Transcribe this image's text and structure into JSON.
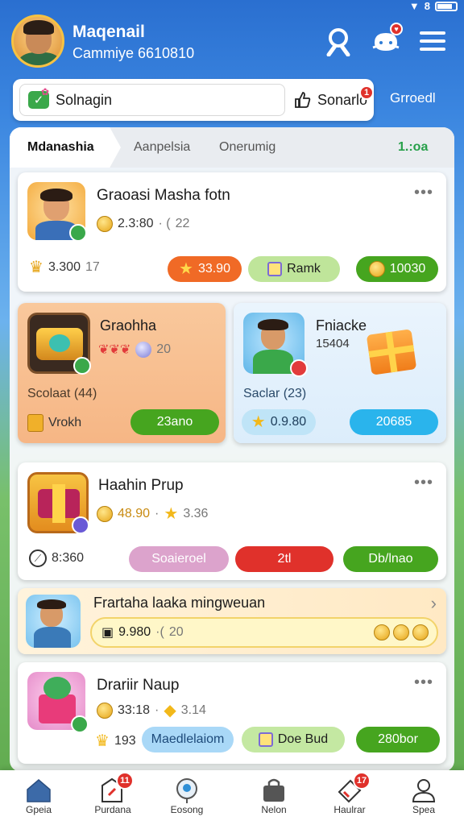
{
  "status": {
    "right_text": "8"
  },
  "header": {
    "username": "Maqenail",
    "subline": "Cammiye 6610810"
  },
  "search": {
    "value": "Solnagin",
    "sort_label": "Sonarlo",
    "sort_badge": "1",
    "group_link": "Grroedl"
  },
  "tabs": [
    {
      "label": "Mdanashia"
    },
    {
      "label": "Aanpelsia"
    },
    {
      "label": "Onerumig"
    }
  ],
  "tabs_right": "1.:oa",
  "cards": {
    "c1": {
      "title": "Graoasi Masha fotn",
      "price": "2.3:80",
      "secondary": "22",
      "score": "3.300",
      "count": "17",
      "btn1": "33.90",
      "btn2": "Ramk",
      "btn3": "10030"
    },
    "c2": {
      "title": "Graohha",
      "rating": "20",
      "subtitle": "Scolaat (44)",
      "tag": "Vrokh",
      "button": "23ano"
    },
    "c3": {
      "title": "Fniacke",
      "sub": "15404",
      "subtitle": "Saclar (23)",
      "chip": "0.9.80",
      "button": "20685"
    },
    "c4": {
      "title": "Haahin Prup",
      "price": "48.90",
      "rating": "3.36",
      "score": "8:360",
      "btn1": "Soaieroel",
      "btn2": "2tl",
      "btn3": "Db/lnao"
    },
    "c5": {
      "title": "Frartaha laaka mingweuan",
      "field": "9.980",
      "field_sub": "20"
    },
    "c6": {
      "title": "Drariir Naup",
      "price": "33:18",
      "rating": "3.14",
      "score": "193",
      "btn1": "Maedlelaiom",
      "btn2": "Doe Bud",
      "btn3": "280bor"
    }
  },
  "nav": [
    {
      "label": "Gpeia"
    },
    {
      "label": "Purdana",
      "badge": "11"
    },
    {
      "label": "Eosong"
    },
    {
      "label": "Nelon"
    },
    {
      "label": "Haulrar",
      "badge": "17"
    },
    {
      "label": "Spea"
    }
  ],
  "colors": {
    "primary": "#2f7cd6",
    "green": "#46a51f",
    "orange": "#f06a26",
    "red": "#e0312b",
    "cyan": "#2ab4ec"
  }
}
